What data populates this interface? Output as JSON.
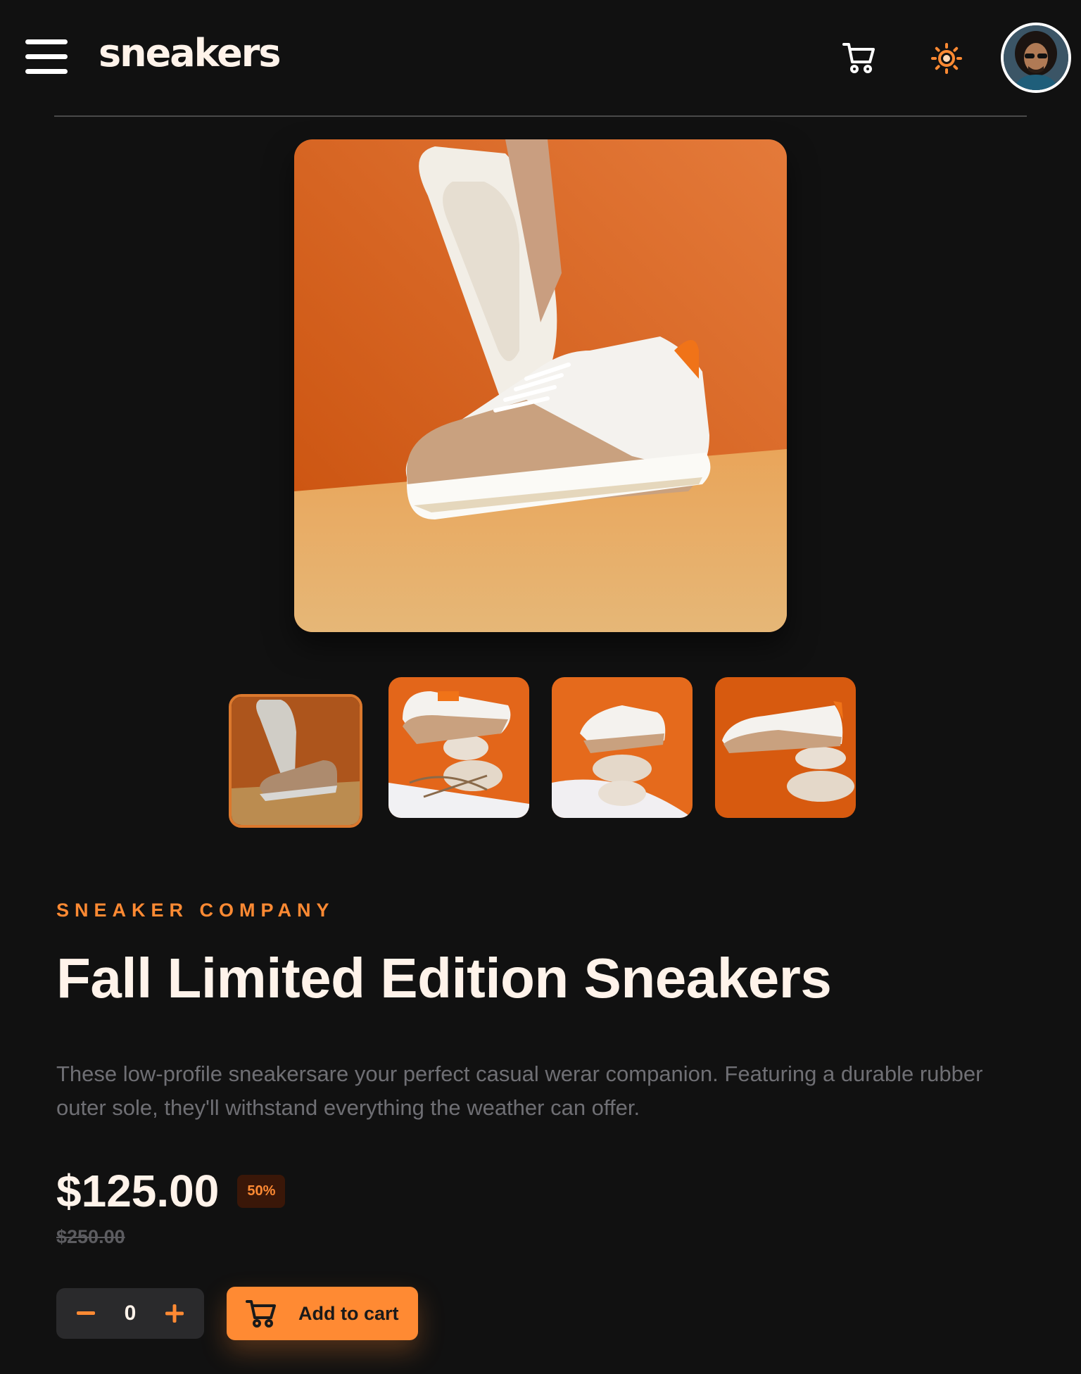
{
  "header": {
    "logo": "sneakers",
    "icons": {
      "menu": "menu-icon",
      "cart": "cart-icon",
      "theme": "sun-icon",
      "avatar": "avatar"
    }
  },
  "gallery": {
    "main_image": "sneaker-main-photo",
    "thumbnails": [
      {
        "name": "thumbnail-1",
        "active": true
      },
      {
        "name": "thumbnail-2",
        "active": false
      },
      {
        "name": "thumbnail-3",
        "active": false
      },
      {
        "name": "thumbnail-4",
        "active": false
      }
    ]
  },
  "product": {
    "company": "SNEAKER COMPANY",
    "title": "Fall Limited Edition Sneakers",
    "description": "These low-profile sneakersare your perfect casual werar companion. Featuring a durable rubber outer sole, they'll withstand everything the weather can offer.",
    "price": "$125.00",
    "discount": "50%",
    "original_price": "$250.00"
  },
  "cart": {
    "quantity": "0",
    "add_label": "Add to cart"
  },
  "colors": {
    "accent": "#FF8A33",
    "background": "#111111",
    "text": "#FFF3EA",
    "muted": "#6f6f74"
  }
}
